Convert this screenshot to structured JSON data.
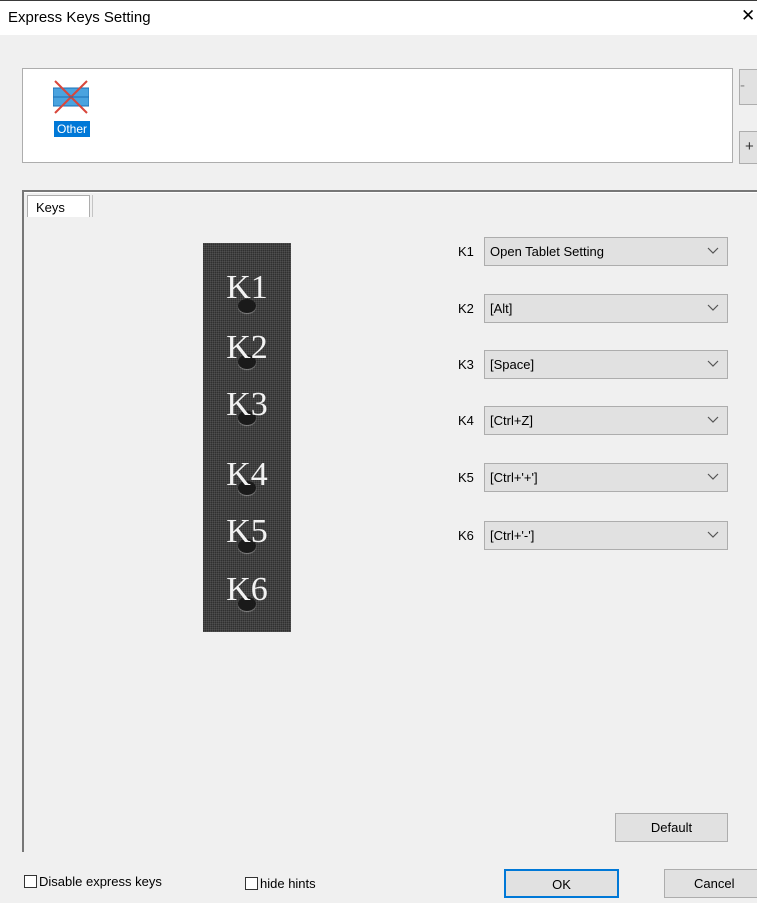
{
  "window": {
    "title": "Express Keys Setting",
    "close_glyph": "✕"
  },
  "app_list": {
    "selected_app": {
      "label": "Other",
      "icon": "other-app-icon"
    },
    "remove_label": "-",
    "add_label": "+"
  },
  "tabs": [
    {
      "label": "Keys"
    }
  ],
  "strip": {
    "keys": [
      "K1",
      "K2",
      "K3",
      "K4",
      "K5",
      "K6"
    ]
  },
  "key_settings": [
    {
      "key": "K1",
      "value": "Open Tablet Setting"
    },
    {
      "key": "K2",
      "value": "[Alt]"
    },
    {
      "key": "K3",
      "value": "[Space]"
    },
    {
      "key": "K4",
      "value": "[Ctrl+Z]"
    },
    {
      "key": "K5",
      "value": "[Ctrl+'+']"
    },
    {
      "key": "K6",
      "value": "[Ctrl+'-']"
    }
  ],
  "buttons": {
    "default": "Default",
    "ok": "OK",
    "cancel": "Cancel"
  },
  "options": {
    "disable_express_keys": {
      "label": "Disable express keys",
      "checked": false
    },
    "hide_hints": {
      "label": "hide hints",
      "checked": false
    }
  },
  "colors": {
    "selection": "#0078d7",
    "dialog_bg": "#f0f0f0",
    "button_bg": "#e1e1e1"
  }
}
